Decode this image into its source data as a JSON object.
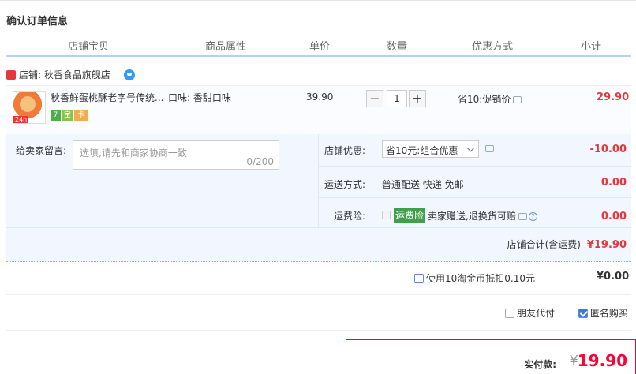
{
  "page_title": "确认订单信息",
  "columns": [
    "店铺宝贝",
    "商品属性",
    "单价",
    "数量",
    "优惠方式",
    "小计"
  ],
  "shop": {
    "label": "店铺: 秋香食品旗舰店"
  },
  "item": {
    "name": "秋香鲜蛋桃酥老字号传统...",
    "attr": "口味: 香甜口味",
    "price": "39.90",
    "quantity": "1",
    "qty_minus": "−",
    "qty_plus": "+",
    "promo": "省10:促销价",
    "subtotal": "29.90",
    "thumb_tag": "24h",
    "badges": [
      "7",
      "宝",
      "卡"
    ]
  },
  "message": {
    "label": "给卖家留言:",
    "placeholder": "选填,请先和商家协商一致",
    "counter": "0/200"
  },
  "coupon": {
    "label": "店铺优惠:",
    "selected": "省10元:组合优惠",
    "amount": "-10.00"
  },
  "shipping": {
    "label": "运送方式:",
    "value": "普通配送 快递 免邮",
    "amount": "0.00"
  },
  "insurance": {
    "label": "运费险:",
    "tag": "运费险",
    "text": "卖家赠送,退换货可赔",
    "amount": "0.00"
  },
  "shop_total": {
    "label": "店铺合计(含运费)",
    "value": "¥19.90"
  },
  "coins": {
    "label": "使用10淘金币抵扣0.10元",
    "amount": "¥0.00"
  },
  "friend_pay": {
    "label": "朋友代付"
  },
  "anonymous": {
    "label": "匿名购买"
  },
  "total": {
    "label": "实付款:",
    "currency": "¥",
    "amount": "19.90"
  },
  "colors": {
    "accent_red": "#e4393c",
    "total_red": "#ff0036",
    "panel_bg": "#f2f7ff",
    "header_line": "#b2d1ff"
  }
}
